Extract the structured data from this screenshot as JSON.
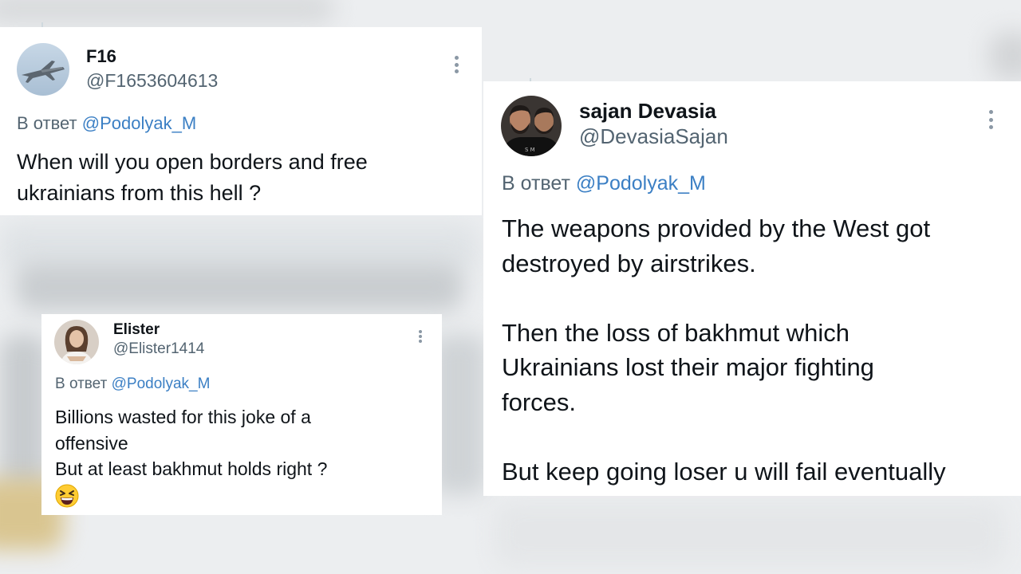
{
  "tweets": [
    {
      "name": "F16",
      "handle": "@F1653604613",
      "reply_prefix": "В ответ",
      "reply_mention": "@Podolyak_M",
      "text": "When will you open borders and free\nukrainians from this hell ?",
      "avatar_icon": "fighter-jet-avatar"
    },
    {
      "name": "Elister",
      "handle": "@Elister1414",
      "reply_prefix": "В ответ",
      "reply_mention": "@Podolyak_M",
      "text": "Billions wasted for this joke of a\noffensive\nBut at least bakhmut holds right ?",
      "emoji": "grinning-squinting-face-emoji",
      "avatar_icon": "woman-portrait-avatar"
    },
    {
      "name": "sajan Devasia",
      "handle": "@DevasiaSajan",
      "reply_prefix": "В ответ",
      "reply_mention": "@Podolyak_M",
      "text": "The weapons provided by the West got\ndestroyed by airstrikes.\n\nThen the loss of bakhmut which\nUkrainians lost their major fighting\nforces.\n\nBut keep going loser u will fail eventually",
      "avatar_icon": "two-men-selfie-avatar"
    }
  ],
  "colors": {
    "mention": "#3b7fc4",
    "secondary_text": "#536471",
    "primary_text": "#0f1419",
    "card_background": "#ffffff"
  }
}
